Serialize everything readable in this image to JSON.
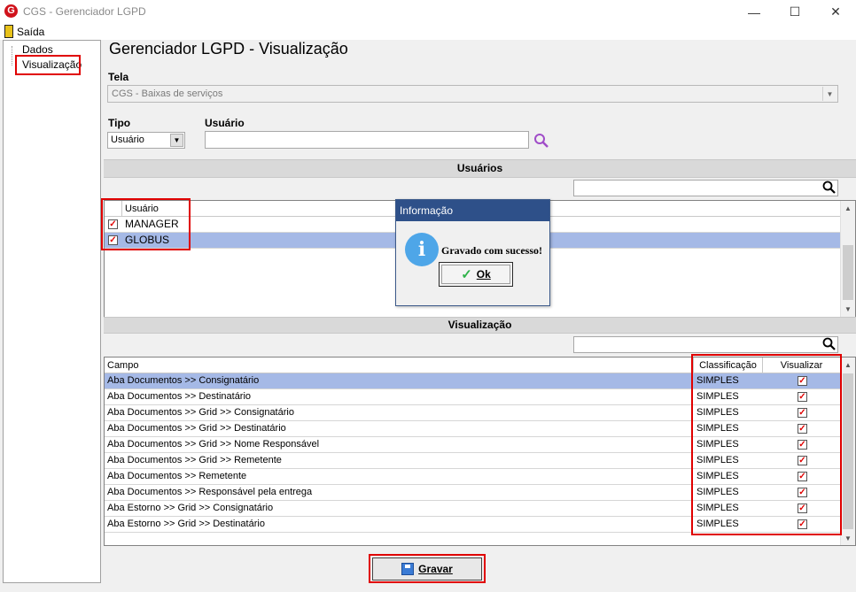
{
  "window": {
    "title": "CGS - Gerenciador LGPD",
    "minimize": "—",
    "maximize": "☐",
    "close": "✕"
  },
  "menu": {
    "exit_label": "Saída"
  },
  "tree": {
    "items": [
      "Dados",
      "Visualização"
    ]
  },
  "page_title": "Gerenciador LGPD - Visualização",
  "tela": {
    "label": "Tela",
    "value": "CGS - Baixas de serviços"
  },
  "tipo": {
    "label": "Tipo",
    "value": "Usuário"
  },
  "usuario": {
    "label": "Usuário",
    "value": ""
  },
  "usuarios_section": {
    "title": "Usuários",
    "search_value": "",
    "column": "Usuário",
    "rows": [
      {
        "name": "MANAGER",
        "checked": true,
        "selected": false
      },
      {
        "name": "GLOBUS",
        "checked": true,
        "selected": true
      }
    ]
  },
  "visualizacao_section": {
    "title": "Visualização",
    "search_value": "",
    "columns": [
      "Campo",
      "Classificação",
      "Visualizar"
    ],
    "rows": [
      {
        "campo": "Aba Documentos >> Consignatário",
        "classificacao": "SIMPLES",
        "visualizar": true,
        "selected": true
      },
      {
        "campo": "Aba Documentos >> Destinatário",
        "classificacao": "SIMPLES",
        "visualizar": true,
        "selected": false
      },
      {
        "campo": "Aba Documentos >> Grid >> Consignatário",
        "classificacao": "SIMPLES",
        "visualizar": true,
        "selected": false
      },
      {
        "campo": "Aba Documentos >> Grid >> Destinatário",
        "classificacao": "SIMPLES",
        "visualizar": true,
        "selected": false
      },
      {
        "campo": "Aba Documentos >> Grid >> Nome Responsável",
        "classificacao": "SIMPLES",
        "visualizar": true,
        "selected": false
      },
      {
        "campo": "Aba Documentos >> Grid >> Remetente",
        "classificacao": "SIMPLES",
        "visualizar": true,
        "selected": false
      },
      {
        "campo": "Aba Documentos >> Remetente",
        "classificacao": "SIMPLES",
        "visualizar": true,
        "selected": false
      },
      {
        "campo": "Aba Documentos >> Responsável pela entrega",
        "classificacao": "SIMPLES",
        "visualizar": true,
        "selected": false
      },
      {
        "campo": "Aba Estorno >> Grid >> Consignatário",
        "classificacao": "SIMPLES",
        "visualizar": true,
        "selected": false
      },
      {
        "campo": "Aba Estorno >> Grid >> Destinatário",
        "classificacao": "SIMPLES",
        "visualizar": true,
        "selected": false
      }
    ]
  },
  "dialog": {
    "title": "Informação",
    "message": "Gravado com sucesso!",
    "ok_label": "Ok"
  },
  "save_label": "Gravar",
  "colors": {
    "title_bar": "#2e5089",
    "selection": "#a5b9e6",
    "highlight": "#e00000",
    "check": "#e00000"
  }
}
